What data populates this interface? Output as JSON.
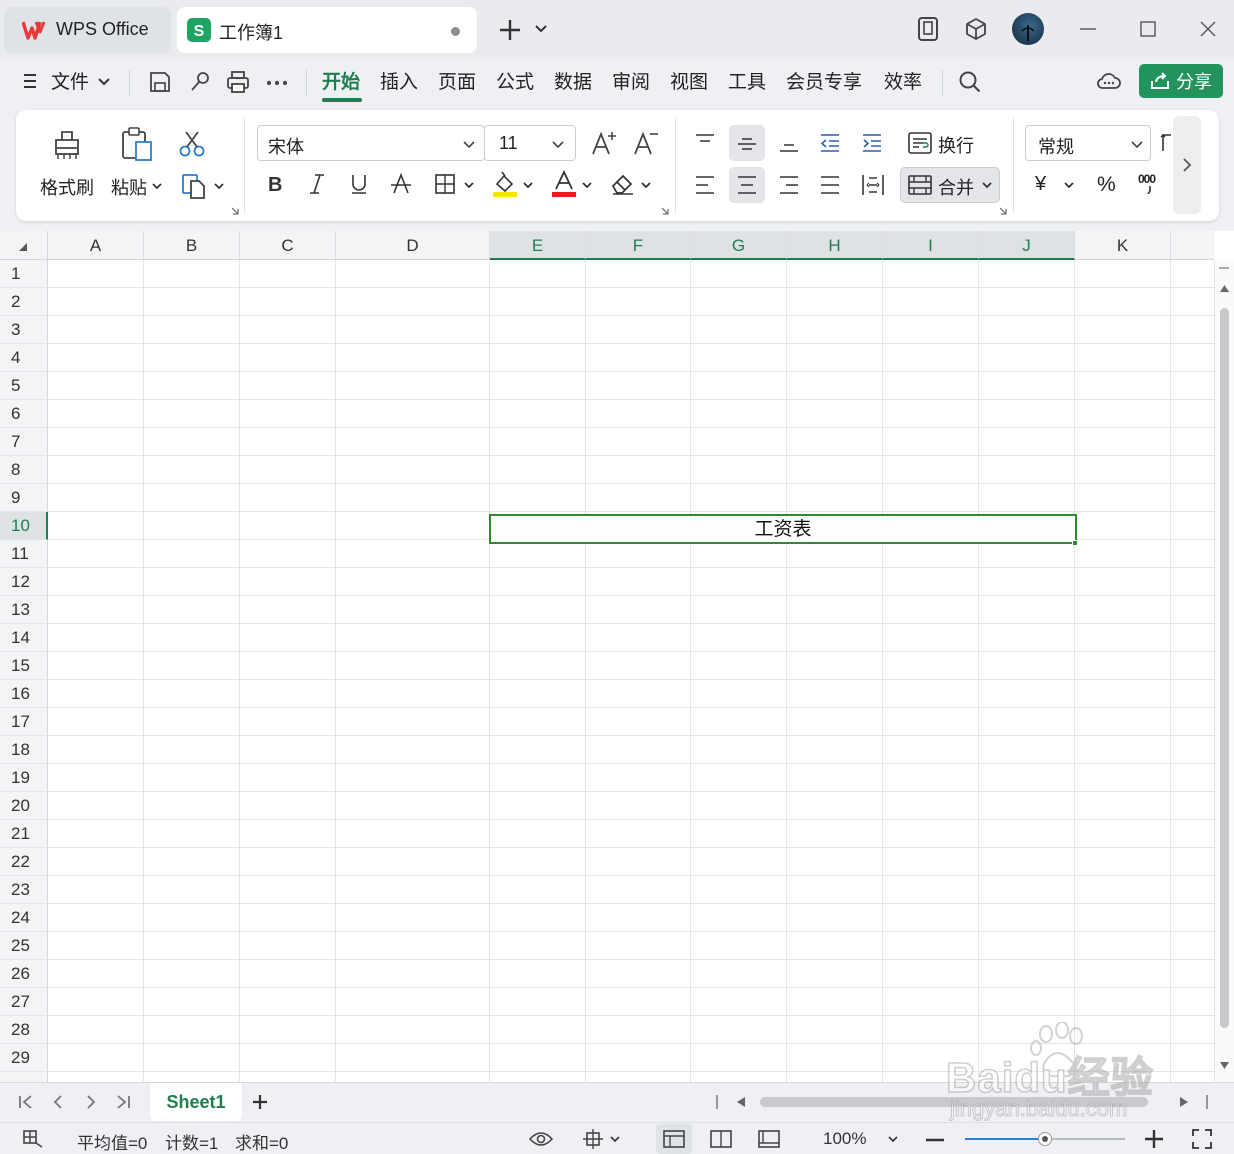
{
  "titlebar": {
    "home_tab": "WPS Office",
    "doc_tab": "工作簿1"
  },
  "menubar": {
    "file": "文件",
    "tabs": [
      "开始",
      "插入",
      "页面",
      "公式",
      "数据",
      "审阅",
      "视图",
      "工具",
      "会员专享",
      "效率"
    ],
    "active_tab": "开始",
    "share": "分享"
  },
  "ribbon": {
    "format_painter": "格式刷",
    "paste": "粘贴",
    "font_name": "宋体",
    "font_size": "11",
    "wrap": "换行",
    "merge": "合并",
    "number_format": "常规",
    "currency": "¥",
    "percent": "%",
    "thousands": "000"
  },
  "sheet": {
    "columns": [
      "A",
      "B",
      "C",
      "D",
      "E",
      "F",
      "G",
      "H",
      "I",
      "J",
      "K"
    ],
    "selected_columns": [
      "E",
      "F",
      "G",
      "H",
      "I",
      "J"
    ],
    "rows": [
      "1",
      "2",
      "3",
      "4",
      "5",
      "6",
      "7",
      "8",
      "9",
      "10",
      "11",
      "12",
      "13",
      "14",
      "15",
      "16",
      "17",
      "18",
      "19",
      "20",
      "21",
      "22",
      "23",
      "24",
      "25",
      "26",
      "27",
      "28",
      "29"
    ],
    "selected_row": "10",
    "merged_cell_text": "工资表"
  },
  "sheet_tabs": {
    "active": "Sheet1"
  },
  "status": {
    "average": "平均值=0",
    "count": "计数=1",
    "sum": "求和=0",
    "zoom": "100%",
    "zoom_level": 0.5
  },
  "watermark": {
    "brand": "Baidu经验",
    "url": "jingyan.baidu.com"
  },
  "colors": {
    "accent": "#1e7e4f",
    "share_button": "#22935d",
    "selection_border": "#2e8b2e",
    "highlight_yellow": "#f5e600",
    "font_red": "#e02020",
    "wps_red": "#e43a3a"
  }
}
